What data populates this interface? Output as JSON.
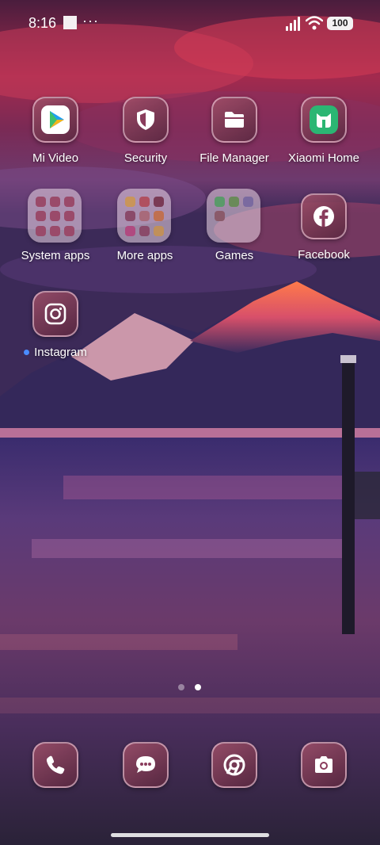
{
  "status_bar": {
    "time": "8:16",
    "dots": "···",
    "battery": "100",
    "icons": [
      "signal-icon",
      "wifi-icon",
      "battery-icon"
    ]
  },
  "apps": {
    "row1": [
      {
        "label": "Mi Video",
        "icon": "mi-video-play-icon"
      },
      {
        "label": "Security",
        "icon": "shield-icon"
      },
      {
        "label": "File Manager",
        "icon": "folder-icon"
      },
      {
        "label": "Xiaomi Home",
        "icon": "mi-home-icon"
      }
    ],
    "row2": [
      {
        "label": "System apps",
        "type": "folder"
      },
      {
        "label": "More apps",
        "type": "folder"
      },
      {
        "label": "Games",
        "type": "folder"
      },
      {
        "label": "Facebook",
        "icon": "facebook-icon"
      }
    ],
    "row3": [
      {
        "label": "Instagram",
        "icon": "instagram-icon",
        "new_indicator": true
      }
    ]
  },
  "pagination": {
    "pages": 2,
    "current": 2
  },
  "dock": [
    {
      "icon": "phone-icon"
    },
    {
      "icon": "messages-icon"
    },
    {
      "icon": "chrome-icon"
    },
    {
      "icon": "camera-icon"
    }
  ],
  "colors": {
    "accent_blue": "#4a8cff",
    "xiaomi_home_green": "#2bb673",
    "icon_tint": "#8a3c5c"
  }
}
